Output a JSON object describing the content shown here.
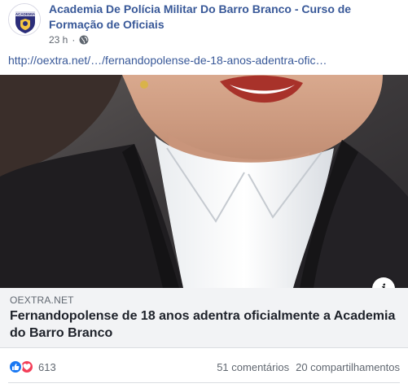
{
  "post": {
    "page_name": "Academia De Polícia Militar Do Barro Branco - Curso de Formação de Oficiais",
    "time": "23 h",
    "separator": "·",
    "privacy_icon": "globe-icon",
    "link_text": "http://oextra.net/…/fernandopolense-de-18-anos-adentra-ofic…",
    "avatar_text": "ACADEMIA"
  },
  "link_card": {
    "source": "OEXTRA.NET",
    "title": "Fernandopolense de 18 anos adentra oficialmente a Academia do Barro Branco",
    "info_icon": "info-icon",
    "info_label": "i"
  },
  "stats": {
    "reaction_icons": [
      "like-icon",
      "love-icon"
    ],
    "reaction_count": "613",
    "comments": "51 comentários",
    "shares": "20 compartilhamentos"
  },
  "colors": {
    "link_blue": "#385898",
    "secondary_text": "#606770",
    "like_blue": "#1877f2",
    "love_red": "#f33e58",
    "card_bg": "#f2f3f5"
  }
}
